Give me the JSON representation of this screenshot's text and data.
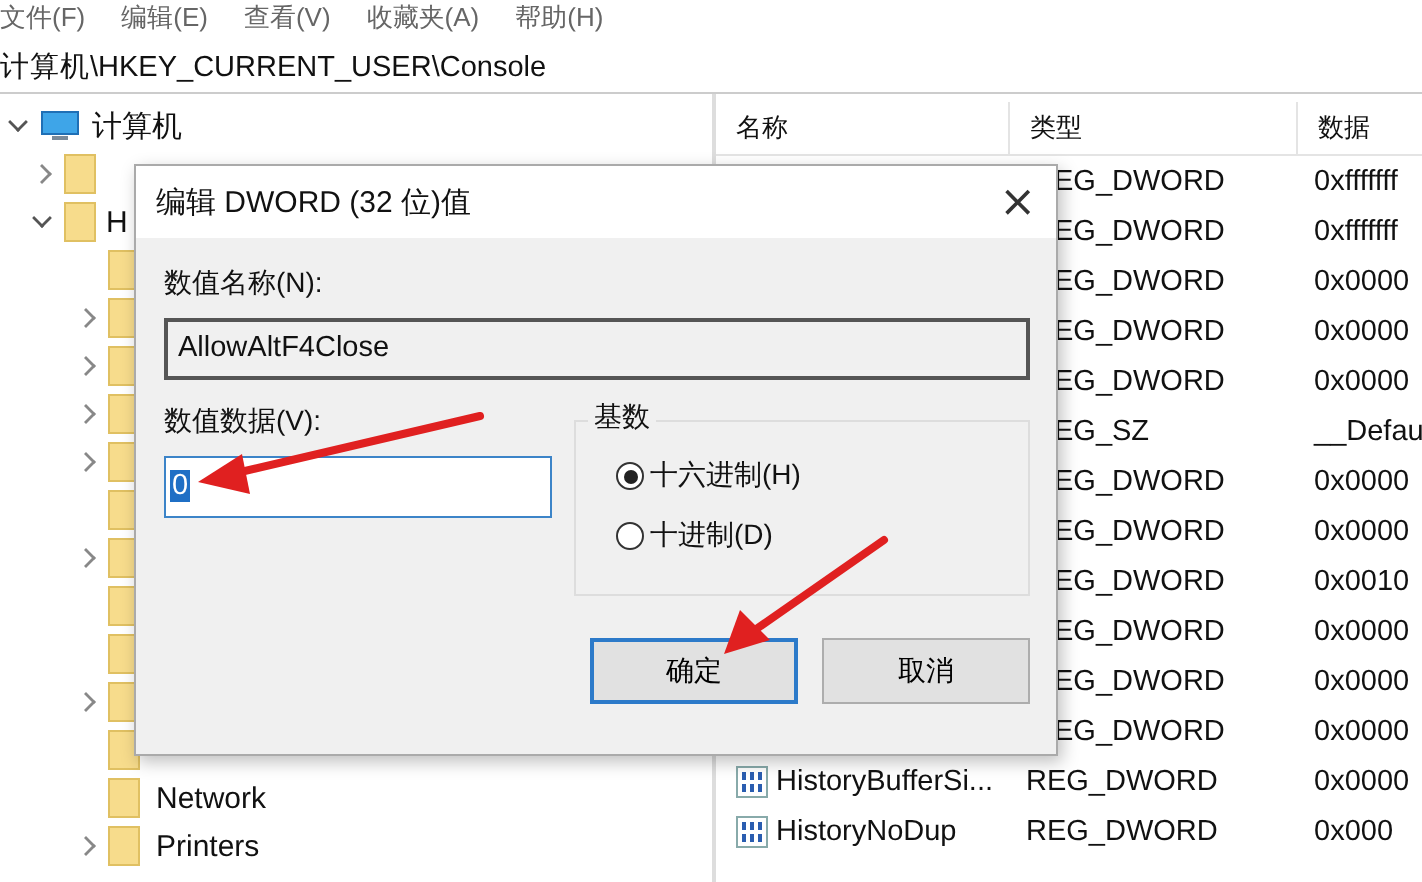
{
  "menu": [
    "文件(F)",
    "编辑(E)",
    "查看(V)",
    "收藏夹(A)",
    "帮助(H)"
  ],
  "address": "计算机\\HKEY_CURRENT_USER\\Console",
  "tree": [
    {
      "name": "计算机",
      "kind": "computer",
      "expanded": true,
      "children": [
        {
          "expanded": false
        },
        {
          "name": "H",
          "expanded": true,
          "children": [
            {
              "expandable": false
            },
            {
              "expandable": true
            },
            {
              "expandable": true
            },
            {
              "expandable": true
            },
            {
              "expandable": true
            },
            {
              "expandable": false
            },
            {
              "expandable": true
            },
            {
              "expandable": false
            },
            {
              "expandable": false
            },
            {
              "expandable": true
            },
            {
              "expandable": false
            },
            {
              "name": "Network",
              "expandable": false
            },
            {
              "name": "Printers",
              "expandable": true
            }
          ]
        }
      ]
    }
  ],
  "list": {
    "columns": [
      "名称",
      "类型",
      "数据"
    ],
    "rows": [
      {
        "type": "EG_DWORD",
        "data": "0xfffffff"
      },
      {
        "type": "EG_DWORD",
        "data": "0xfffffff"
      },
      {
        "type": "EG_DWORD",
        "data": "0x0000"
      },
      {
        "type": "EG_DWORD",
        "data": "0x0000"
      },
      {
        "type": "EG_DWORD",
        "data": "0x0000"
      },
      {
        "type": "EG_SZ",
        "data": "__Defau"
      },
      {
        "type": "EG_DWORD",
        "data": "0x0000"
      },
      {
        "type": "EG_DWORD",
        "data": "0x0000"
      },
      {
        "type": "EG_DWORD",
        "data": "0x0010"
      },
      {
        "type": "EG_DWORD",
        "data": "0x0000"
      },
      {
        "type": "EG_DWORD",
        "data": "0x0000"
      },
      {
        "type": "EG_DWORD",
        "data": "0x0000"
      },
      {
        "name": "HistoryBufferSi...",
        "type": "REG_DWORD",
        "data": "0x0000"
      },
      {
        "name": "HistoryNoDup",
        "type": "REG_DWORD",
        "data": "0x000"
      }
    ]
  },
  "dialog": {
    "title": "编辑 DWORD (32 位)值",
    "close": "×",
    "name_label": "数值名称(N):",
    "name_value": "AllowAltF4Close",
    "data_label": "数值数据(V):",
    "data_value": "0",
    "base_label": "基数",
    "bases": [
      {
        "label": "十六进制(H)",
        "selected": true
      },
      {
        "label": "十进制(D)",
        "selected": false
      }
    ],
    "buttons": [
      {
        "label": "确定",
        "default": true
      },
      {
        "label": "取消",
        "default": false
      }
    ]
  }
}
